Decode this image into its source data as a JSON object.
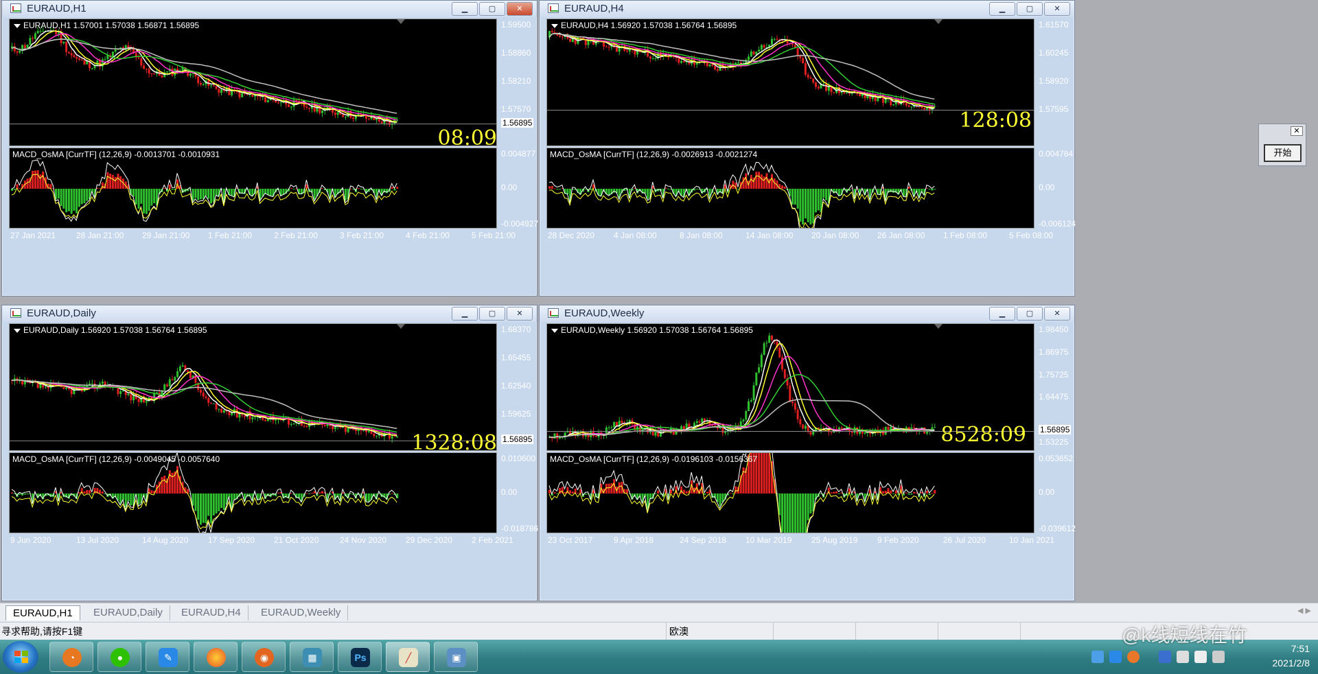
{
  "windows": [
    {
      "id": "h1",
      "title": "EURAUD,H1",
      "header": "EURAUD,H1  1.57001 1.57038 1.56871 1.56895",
      "macd_label": "MACD_OsMA [CurrTF] (12,26,9) -0.0013701 -0.0010931",
      "timer": "08:09",
      "y_ticks": [
        "1.59500",
        "1.58860",
        "1.58210",
        "1.57570",
        "1.56895"
      ],
      "macd_ticks": [
        "0.004877",
        "0.00",
        "-0.004927"
      ],
      "x_ticks": [
        "27 Jan 2021",
        "28 Jan 21:00",
        "29 Jan 21:00",
        "1 Feb 21:00",
        "2 Feb 21:00",
        "3 Feb 21:00",
        "4 Feb 21:00",
        "5 Feb 21:00"
      ],
      "active": true
    },
    {
      "id": "h4",
      "title": "EURAUD,H4",
      "header": "EURAUD,H4  1.56920 1.57038 1.56764 1.56895",
      "macd_label": "MACD_OsMA [CurrTF] (12,26,9) -0.0026913 -0.0021274",
      "timer": "128:08",
      "y_ticks": [
        "1.61570",
        "1.60245",
        "1.58920",
        "1.57595",
        ""
      ],
      "macd_ticks": [
        "0.004784",
        "0.00",
        "-0.006124"
      ],
      "x_ticks": [
        "28 Dec 2020",
        "4 Jan 08:00",
        "8 Jan 08:00",
        "14 Jan 08:00",
        "20 Jan 08:00",
        "26 Jan 08:00",
        "1 Feb 08:00",
        "5 Feb 08:00"
      ],
      "active": false
    },
    {
      "id": "daily",
      "title": "EURAUD,Daily",
      "header": "EURAUD,Daily  1.56920 1.57038 1.56764 1.56895",
      "macd_label": "MACD_OsMA [CurrTF] (12,26,9) -0.0049045 -0.0057640",
      "timer": "1328:08",
      "y_ticks": [
        "1.68370",
        "1.65455",
        "1.62540",
        "1.59625",
        "1.56895"
      ],
      "macd_ticks": [
        "0.010600",
        "0.00",
        "-0.018786"
      ],
      "x_ticks": [
        "9 Jun 2020",
        "13 Jul 2020",
        "14 Aug 2020",
        "17 Sep 2020",
        "21 Oct 2020",
        "24 Nov 2020",
        "29 Dec 2020",
        "2 Feb 2021"
      ],
      "active": false
    },
    {
      "id": "weekly",
      "title": "EURAUD,Weekly",
      "header": "EURAUD,Weekly  1.56920 1.57038 1.56764 1.56895",
      "macd_label": "MACD_OsMA [CurrTF] (12,26,9) -0.0196103 -0.0156367",
      "timer": "8528:09",
      "y_ticks": [
        "1.98450",
        "1.86975",
        "1.75725",
        "1.64475",
        "1.56895",
        "1.53225"
      ],
      "macd_ticks": [
        "0.053652",
        "0.00",
        "-0.039612"
      ],
      "x_ticks": [
        "23 Oct 2017",
        "9 Apr 2018",
        "24 Sep 2018",
        "10 Mar 2019",
        "25 Aug 2019",
        "9 Feb 2020",
        "26 Jul 2020",
        "10 Jan 2021"
      ],
      "active": false
    }
  ],
  "tabs": [
    "EURAUD,H1",
    "EURAUD,Daily",
    "EURAUD,H4",
    "EURAUD,Weekly"
  ],
  "status": {
    "help": "寻求帮助,请按F1键",
    "profile": "欧澳"
  },
  "dialog": {
    "button": "开始"
  },
  "taskbar": {
    "time": "7:51",
    "date": "2021/2/8",
    "apps": [
      "browser",
      "wechat",
      "pen-app",
      "firefox",
      "bandit-app",
      "qr-app",
      "photoshop",
      "chart-app",
      "photo-viewer"
    ]
  },
  "watermark": "@k线短线在竹",
  "colors": {
    "bull": "#2fbf2f",
    "bear": "#e02020",
    "ma1": "#ffffff",
    "ma2": "#ffff33",
    "ma3": "#ff33cc",
    "ma4": "#33cc33",
    "ma5": "#c0c0c0"
  }
}
